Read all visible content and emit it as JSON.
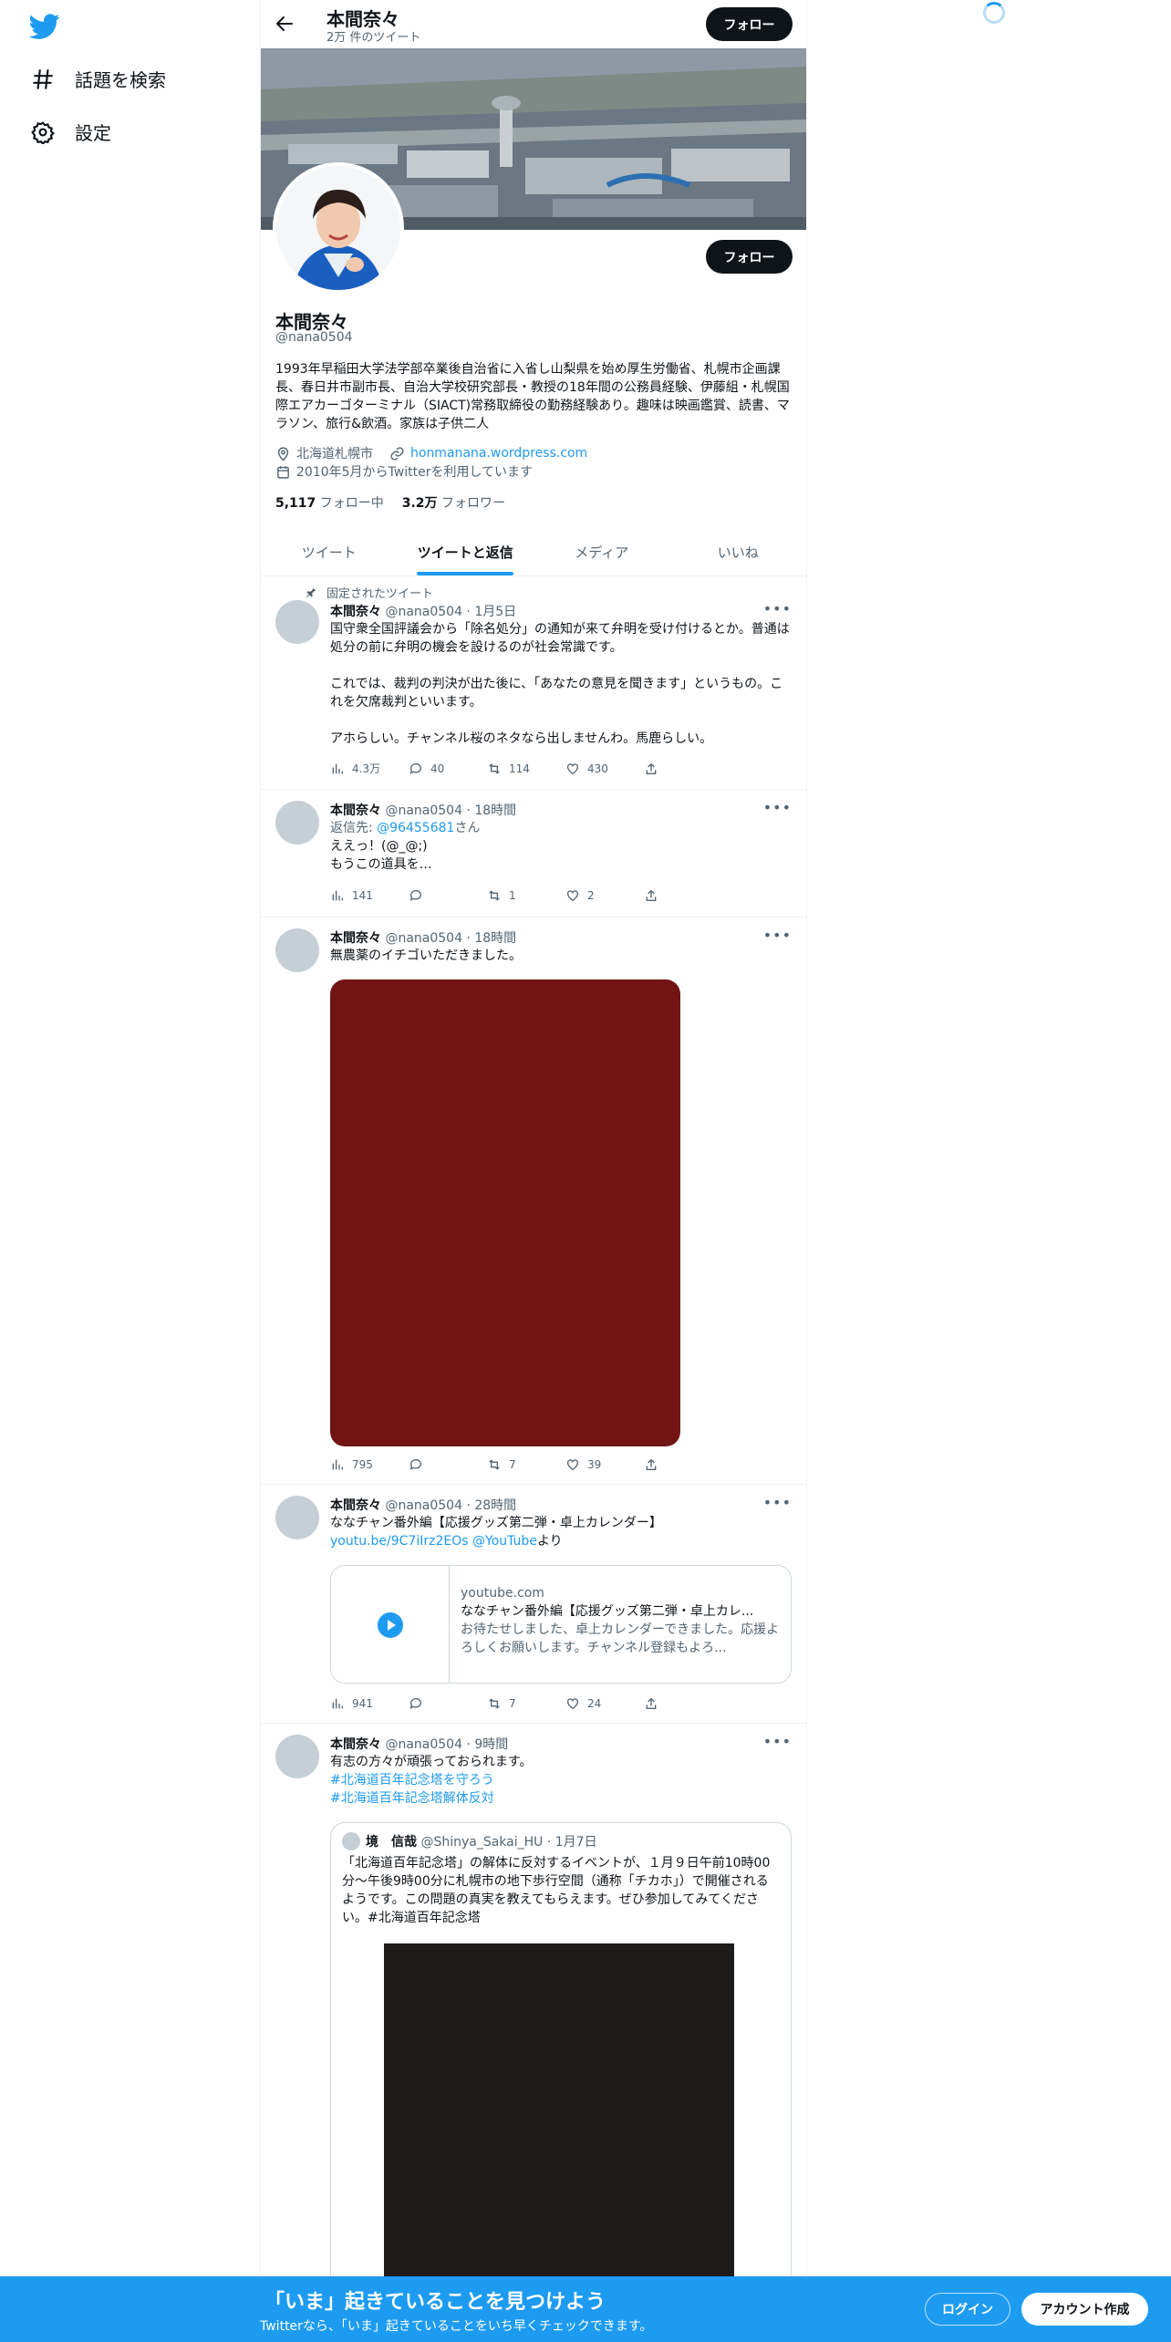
{
  "nav": {
    "explore_label": "話題を検索",
    "settings_label": "設定"
  },
  "topbar": {
    "name": "本間奈々",
    "tweet_count": "2万 件のツイート",
    "follow_label": "フォロー"
  },
  "profile": {
    "name": "本間奈々",
    "handle": "@nana0504",
    "follow_label": "フォロー",
    "bio": "1993年早稲田大学法学部卒業後自治省に入省し山梨県を始め厚生労働省、札幌市企画課長、春日井市副市長、自治大学校研究部長・教授の18年間の公務員経験、伊藤組・札幌国際エアカーゴターミナル（SIACT)常務取締役の勤務経験あり。趣味は映画鑑賞、読書、マラソン、旅行&飲酒。家族は子供二人",
    "location": "北海道札幌市",
    "website": "honmanana.wordpress.com",
    "joined": "2010年5月からTwitterを利用しています",
    "following_count": "5,117",
    "following_label": "フォロー中",
    "followers_count": "3.2万",
    "followers_label": "フォロワー"
  },
  "tabs": [
    {
      "label": "ツイート"
    },
    {
      "label": "ツイートと返信"
    },
    {
      "label": "メディア"
    },
    {
      "label": "いいね"
    }
  ],
  "tweets": [
    {
      "pinned_label": "固定されたツイート",
      "name": "本間奈々",
      "meta": "@nana0504 · 1月5日",
      "text": "国守衆全国評議会から「除名処分」の通知が来て弁明を受け付けるとか。普通は処分の前に弁明の機会を設けるのが社会常識です。\n\nこれでは、裁判の判決が出た後に、「あなたの意見を聞きます」というもの。これを欠席裁判といいます。\n\nアホらしい。チャンネル桜のネタなら出しませんわ。馬鹿らしい。",
      "views": "4.3万",
      "replies": "40",
      "retweets": "114",
      "likes": "430"
    },
    {
      "name": "本間奈々",
      "meta": "@nana0504 · 18時間",
      "reply_prefix": "返信先: ",
      "reply_to": "@96455681",
      "reply_suffix": "さん",
      "text": "ええっ！(@_@;)\nもうこの道具を…",
      "views": "141",
      "replies": "",
      "retweets": "1",
      "likes": "2"
    },
    {
      "name": "本間奈々",
      "meta": "@nana0504 · 18時間",
      "text": "無農薬のイチゴいただきました。",
      "views": "795",
      "replies": "",
      "retweets": "7",
      "likes": "39"
    },
    {
      "name": "本間奈々",
      "meta": "@nana0504 · 28時間",
      "text": "ななチャン番外編【応援グッズ第二弾・卓上カレンダー】",
      "link1": "youtu.be/9C7iIrz2EOs",
      "link2": "@YouTube",
      "link_suffix": "より",
      "card_domain": "youtube.com",
      "card_title": "ななチャン番外編【応援グッズ第二弾・卓上カレ...",
      "card_desc": "お待たせしました、卓上カレンダーできました。応援よろしくお願いします。チャンネル登録もよろ...",
      "views": "941",
      "replies": "",
      "retweets": "7",
      "likes": "24"
    },
    {
      "name": "本間奈々",
      "meta": "@nana0504 · 9時間",
      "text": "有志の方々が頑張っておられます。",
      "hashtag1": "#北海道百年記念塔を守ろう",
      "hashtag2": "#北海道百年記念塔解体反対",
      "quote_name": "境　信哉",
      "quote_meta": "@Shinya_Sakai_HU · 1月7日",
      "quote_text": "「北海道百年記念塔」の解体に反対するイベントが、１月９日午前10時00分～午後9時00分に札幌市の地下歩行空間（通称「チカホ」）で開催されるようです。この問題の真実を教えてもらえます。ぜひ参加してみてください。#北海道百年記念塔"
    }
  ],
  "bottom": {
    "title": "「いま」起きていることを見つけよう",
    "subtitle": "Twitterなら、「いま」起きていることをいち早くチェックできます。",
    "login_label": "ログイン",
    "signup_label": "アカウント作成"
  },
  "colors": {
    "accent": "#1d9bf0",
    "text": "#0f1419",
    "secondary": "#536471",
    "strawberry_image": "#731414"
  }
}
